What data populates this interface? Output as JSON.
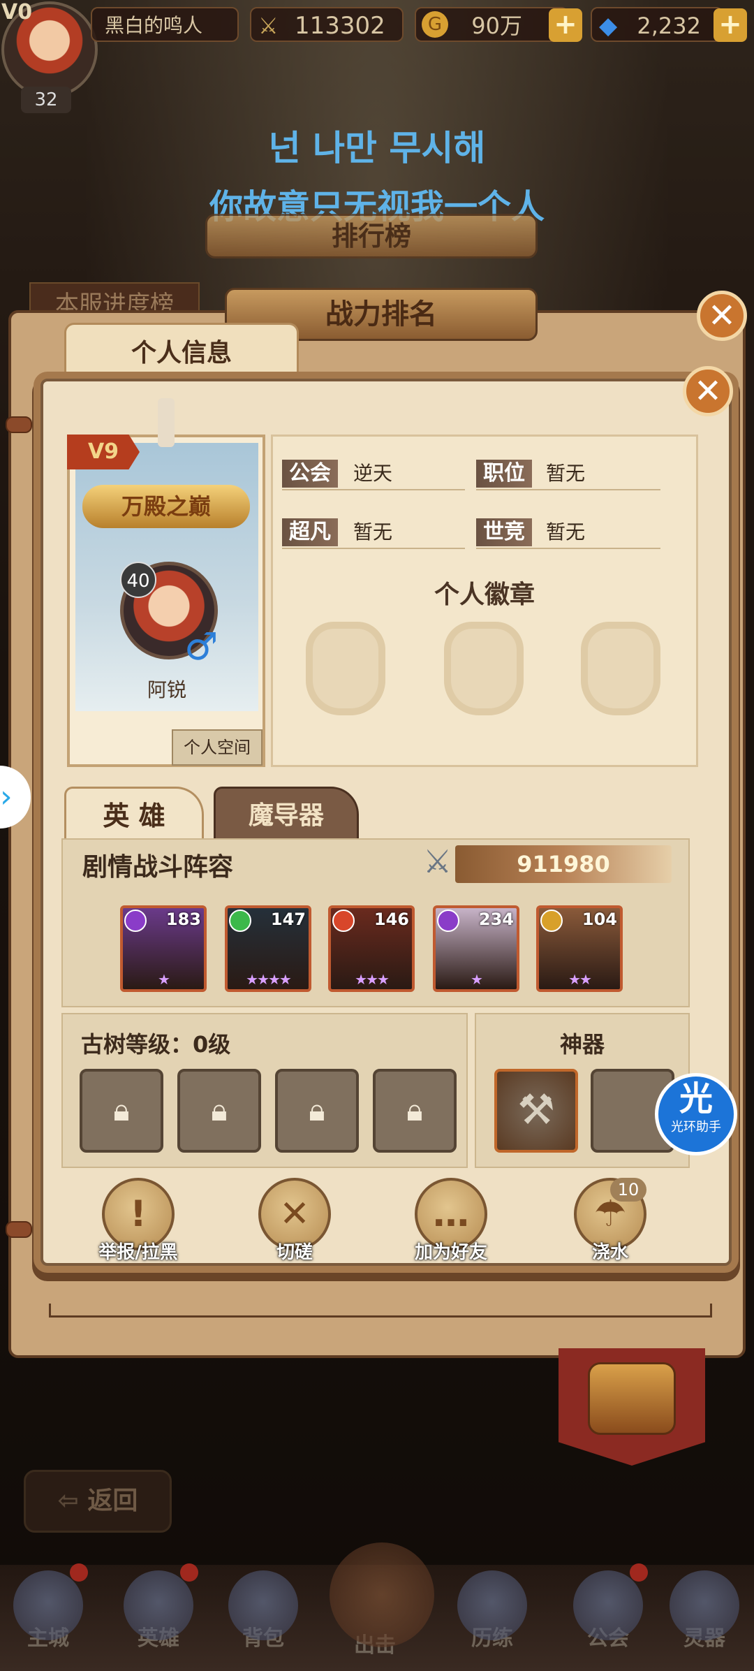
{
  "top": {
    "vip": "V0",
    "level": "32",
    "player_name": "黑白的鸣人",
    "combat_power": "113302",
    "gold": "90万",
    "diamonds": "2,232"
  },
  "subtitles": {
    "korean": "넌 나만 무시해",
    "chinese": "你故意只无视我一个人"
  },
  "ranking": {
    "title": "排行榜",
    "tab_left": "本服进度榜",
    "ribbon": "战力排名"
  },
  "profile": {
    "tab_label": "个人信息",
    "vip": "V9",
    "title_badge": "万殿之巅",
    "hero_level": "40",
    "gender_symbol": "♂",
    "hero_name": "阿锐",
    "space_button": "个人空间",
    "fields": [
      {
        "label": "公会",
        "value": "逆天"
      },
      {
        "label": "职位",
        "value": "暂无"
      },
      {
        "label": "超凡",
        "value": "暂无"
      },
      {
        "label": "世竞",
        "value": "暂无"
      }
    ],
    "badges_title": "个人徽章"
  },
  "tabs": {
    "hero": "英 雄",
    "mage": "魔导器"
  },
  "lineup": {
    "title": "剧情战斗阵容",
    "power": "911980",
    "heroes": [
      {
        "level": "183",
        "element_color": "#8a3cc8",
        "stars": "★",
        "bg": "#6a3a8a"
      },
      {
        "level": "147",
        "element_color": "#3cb84a",
        "stars": "★★★★",
        "bg": "#25303a"
      },
      {
        "level": "146",
        "element_color": "#d8462a",
        "stars": "★★★",
        "bg": "#6a2a1e"
      },
      {
        "level": "234",
        "element_color": "#8a3cc8",
        "stars": "★",
        "bg": "#c7b3c8"
      },
      {
        "level": "104",
        "element_color": "#d8a02a",
        "stars": "★★",
        "bg": "#8a5a3a"
      }
    ]
  },
  "tree": {
    "title": "古树等级：0级"
  },
  "artifact": {
    "title": "神器"
  },
  "actions": [
    {
      "label": "举报/拉黑",
      "icon": "warning-icon",
      "glyph": "!"
    },
    {
      "label": "切磋",
      "icon": "crossed-swords-icon",
      "glyph": "✕"
    },
    {
      "label": "加为好友",
      "icon": "chat-bubble-icon",
      "glyph": "…"
    },
    {
      "label": "浇水",
      "icon": "watering-can-icon",
      "glyph": "☂",
      "count": "10"
    }
  ],
  "helper": {
    "glyph": "光",
    "label": "光环助手"
  },
  "back": "返回",
  "nav": [
    {
      "label": "主城",
      "icon": "castle-icon"
    },
    {
      "label": "英雄",
      "icon": "helmet-icon"
    },
    {
      "label": "背包",
      "icon": "backpack-icon"
    },
    {
      "label": "出击",
      "icon": "sword-icon"
    },
    {
      "label": "历练",
      "icon": "trial-icon"
    },
    {
      "label": "公会",
      "icon": "guild-icon"
    },
    {
      "label": "灵器",
      "icon": "orb-icon"
    }
  ]
}
